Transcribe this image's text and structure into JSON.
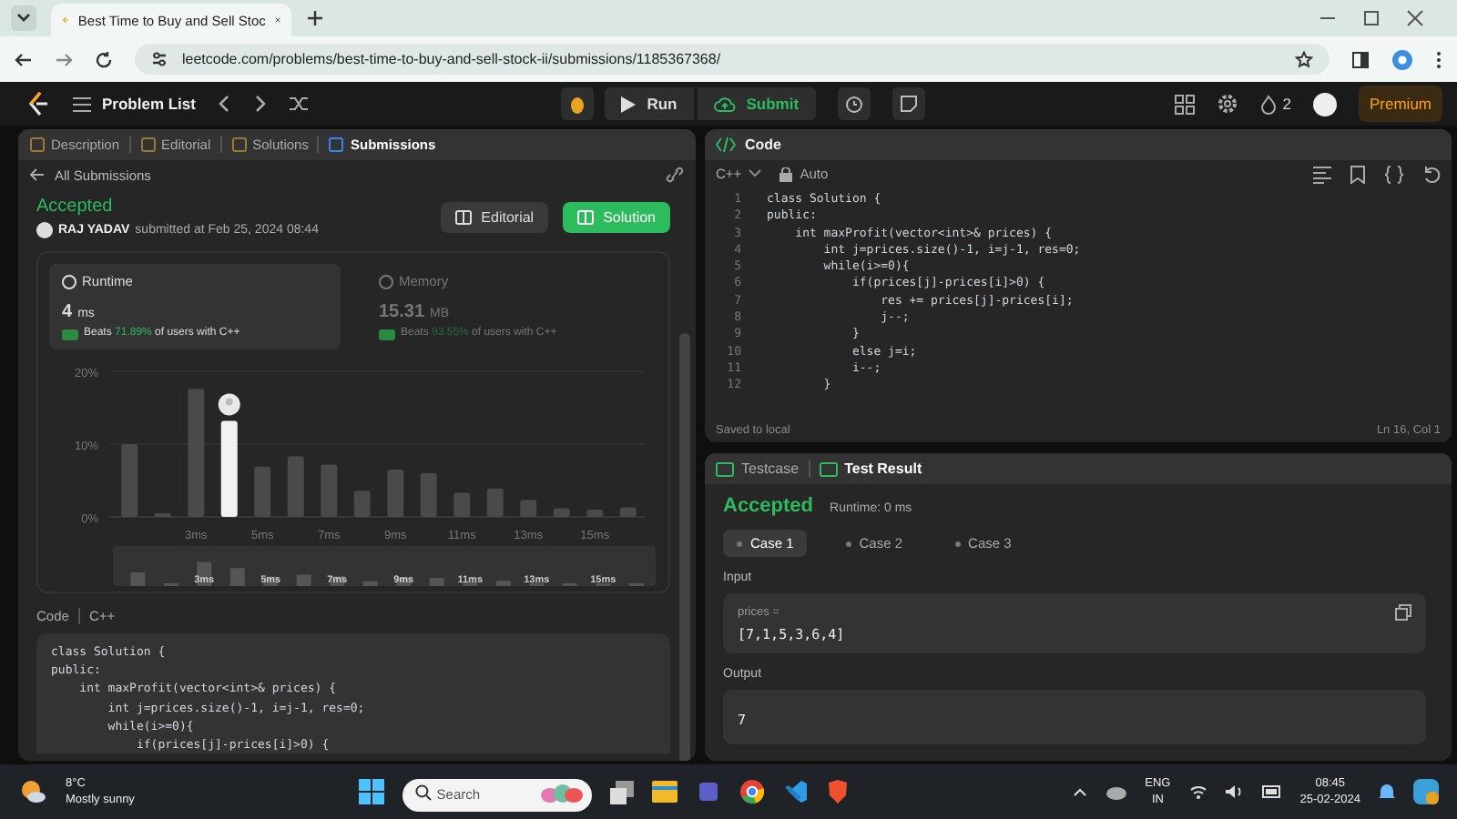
{
  "browser": {
    "tab_title": "Best Time to Buy and Sell Stoc",
    "url": "leetcode.com/problems/best-time-to-buy-and-sell-stock-ii/submissions/1185367368/"
  },
  "nav": {
    "problem_list": "Problem List",
    "run": "Run",
    "submit": "Submit",
    "streak": "2",
    "premium": "Premium"
  },
  "left_tabs": [
    {
      "label": "Description",
      "selected": false
    },
    {
      "label": "Editorial",
      "selected": false
    },
    {
      "label": "Solutions",
      "selected": false
    },
    {
      "label": "Submissions",
      "selected": true
    }
  ],
  "back_link": "All Submissions",
  "result": {
    "status": "Accepted",
    "user": "RAJ YADAV",
    "submitted": "submitted at Feb 25, 2024 08:44"
  },
  "actions": [
    {
      "label": "Editorial",
      "kind": "secondary"
    },
    {
      "label": "Solution",
      "kind": "primary"
    }
  ],
  "stats": [
    {
      "title": "Runtime",
      "value": "4",
      "unit": "ms",
      "beats": "Beats",
      "percent": "71.89%",
      "suffix": "of users with C++",
      "selected": true
    },
    {
      "title": "Memory",
      "value": "15.31",
      "unit": "MB",
      "beats": "Beats",
      "percent": "93.55%",
      "suffix": "of users with C++",
      "selected": false
    }
  ],
  "chart_data": {
    "type": "bar",
    "x": [
      1,
      2,
      3,
      4,
      5,
      6,
      7,
      8,
      9,
      10,
      11,
      12,
      13,
      14,
      15,
      16
    ],
    "values": [
      10,
      0.5,
      17.6,
      13.2,
      6.9,
      8.3,
      7.2,
      3.6,
      6.5,
      6,
      3.3,
      3.9,
      2.3,
      1.2,
      1,
      1.3
    ],
    "xlim": [
      0.5,
      16.5
    ],
    "ylim": [
      0,
      20
    ],
    "yticks": [
      {
        "value": 0,
        "label": "0%"
      },
      {
        "value": 10,
        "label": "10%"
      },
      {
        "value": 20,
        "label": "20%"
      }
    ],
    "xticks": [
      {
        "value": 3,
        "label": "3ms"
      },
      {
        "value": 5,
        "label": "5ms"
      },
      {
        "value": 7,
        "label": "7ms"
      },
      {
        "value": 9,
        "label": "9ms"
      },
      {
        "value": 11,
        "label": "11ms"
      },
      {
        "value": 13,
        "label": "13ms"
      },
      {
        "value": 15,
        "label": "15ms"
      }
    ]
  },
  "navigator": {
    "labels": [
      "3ms",
      "5ms",
      "7ms",
      "9ms",
      "11ms",
      "13ms",
      "15ms"
    ]
  },
  "code_section": {
    "label": "Code",
    "language": "C++",
    "lines": [
      "class Solution {",
      "public:",
      "    int maxProfit(vector<int>& prices) {",
      "        int j=prices.size()-1, i=j-1, res=0;",
      "        while(i>=0){",
      "            if(prices[j]-prices[i]>0) {"
    ]
  },
  "editor": {
    "title": "Code",
    "language": "C++",
    "mode": "Auto",
    "line_numbers": [
      "1",
      "2",
      "3",
      "4",
      "5",
      "6",
      "7",
      "8",
      "9",
      "10",
      "11",
      "12"
    ],
    "lines": [
      "class Solution {",
      "public:",
      "    int maxProfit(vector<int>& prices) {",
      "        int j=prices.size()-1, i=j-1, res=0;",
      "        while(i>=0){",
      "            if(prices[j]-prices[i]>0) {",
      "                res += prices[j]-prices[i];",
      "                j--;",
      "            }",
      "            else j=i;",
      "            i--;",
      "        }"
    ],
    "status": "Saved to local",
    "cursor": "Ln 16, Col 1"
  },
  "bottom_tabs": [
    {
      "label": "Testcase",
      "selected": false
    },
    {
      "label": "Test Result",
      "selected": true
    }
  ],
  "test_result": {
    "status": "Accepted",
    "runtime": "Runtime: 0 ms",
    "cases": [
      {
        "label": "Case 1",
        "selected": true
      },
      {
        "label": "Case 2",
        "selected": false
      },
      {
        "label": "Case 3",
        "selected": false
      }
    ],
    "input_label": "Input",
    "param": "prices =",
    "input_value": "[7,1,5,3,6,4]",
    "output_label": "Output",
    "output_value": "7"
  },
  "taskbar": {
    "temperature": "8°C",
    "weather": "Mostly sunny",
    "search": {
      "placeholder": "Search"
    },
    "language": "ENG",
    "region": "IN",
    "time": "08:45",
    "date": "25-02-2024"
  }
}
